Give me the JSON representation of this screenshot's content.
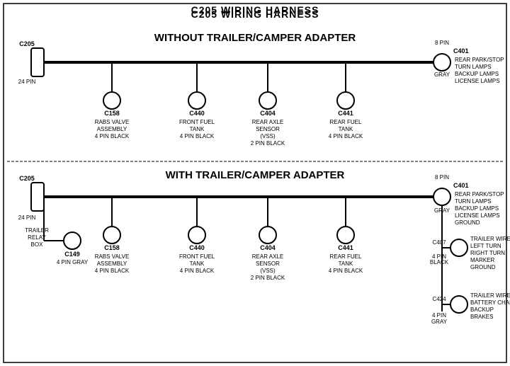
{
  "title": "C205 WIRING HARNESS",
  "top_section": {
    "label": "WITHOUT  TRAILER/CAMPER  ADAPTER",
    "left_connector": {
      "id": "C205",
      "pins": "24 PIN"
    },
    "right_connector": {
      "id": "C401",
      "pins": "8 PIN",
      "color": "GRAY",
      "desc": "REAR PARK/STOP\nTURN LAMPS\nBACKUP LAMPS\nLICENSE LAMPS"
    },
    "connectors": [
      {
        "id": "C158",
        "desc": "RABS VALVE\nASSEMBLY\n4 PIN BLACK"
      },
      {
        "id": "C440",
        "desc": "FRONT FUEL\nTANK\n4 PIN BLACK"
      },
      {
        "id": "C404",
        "desc": "REAR AXLE\nSENSOR\n(VSS)\n2 PIN BLACK"
      },
      {
        "id": "C441",
        "desc": "REAR FUEL\nTANK\n4 PIN BLACK"
      }
    ]
  },
  "bottom_section": {
    "label": "WITH  TRAILER/CAMPER  ADAPTER",
    "left_connector": {
      "id": "C205",
      "pins": "24 PIN"
    },
    "right_connector": {
      "id": "C401",
      "pins": "8 PIN",
      "color": "GRAY",
      "desc": "REAR PARK/STOP\nTURN LAMPS\nBACKUP LAMPS\nLICENSE LAMPS\nGROUND"
    },
    "extra_left": {
      "label": "TRAILER\nRELAY\nBOX",
      "id": "C149",
      "pins": "4 PIN GRAY"
    },
    "connectors": [
      {
        "id": "C158",
        "desc": "RABS VALVE\nASSEMBLY\n4 PIN BLACK"
      },
      {
        "id": "C440",
        "desc": "FRONT FUEL\nTANK\n4 PIN BLACK"
      },
      {
        "id": "C404",
        "desc": "REAR AXLE\nSENSOR\n(VSS)\n2 PIN BLACK"
      },
      {
        "id": "C441",
        "desc": "REAR FUEL\nTANK\n4 PIN BLACK"
      }
    ],
    "right_extra": [
      {
        "id": "C407",
        "pins": "4 PIN\nBLACK",
        "desc": "TRAILER WIRES\nLEFT TURN\nRIGHT TURN\nMARKER\nGROUND"
      },
      {
        "id": "C424",
        "pins": "4 PIN\nGRAY",
        "desc": "TRAILER WIRES\nBATTERY CHARGE\nBACKUP\nBRAKES"
      }
    ]
  }
}
